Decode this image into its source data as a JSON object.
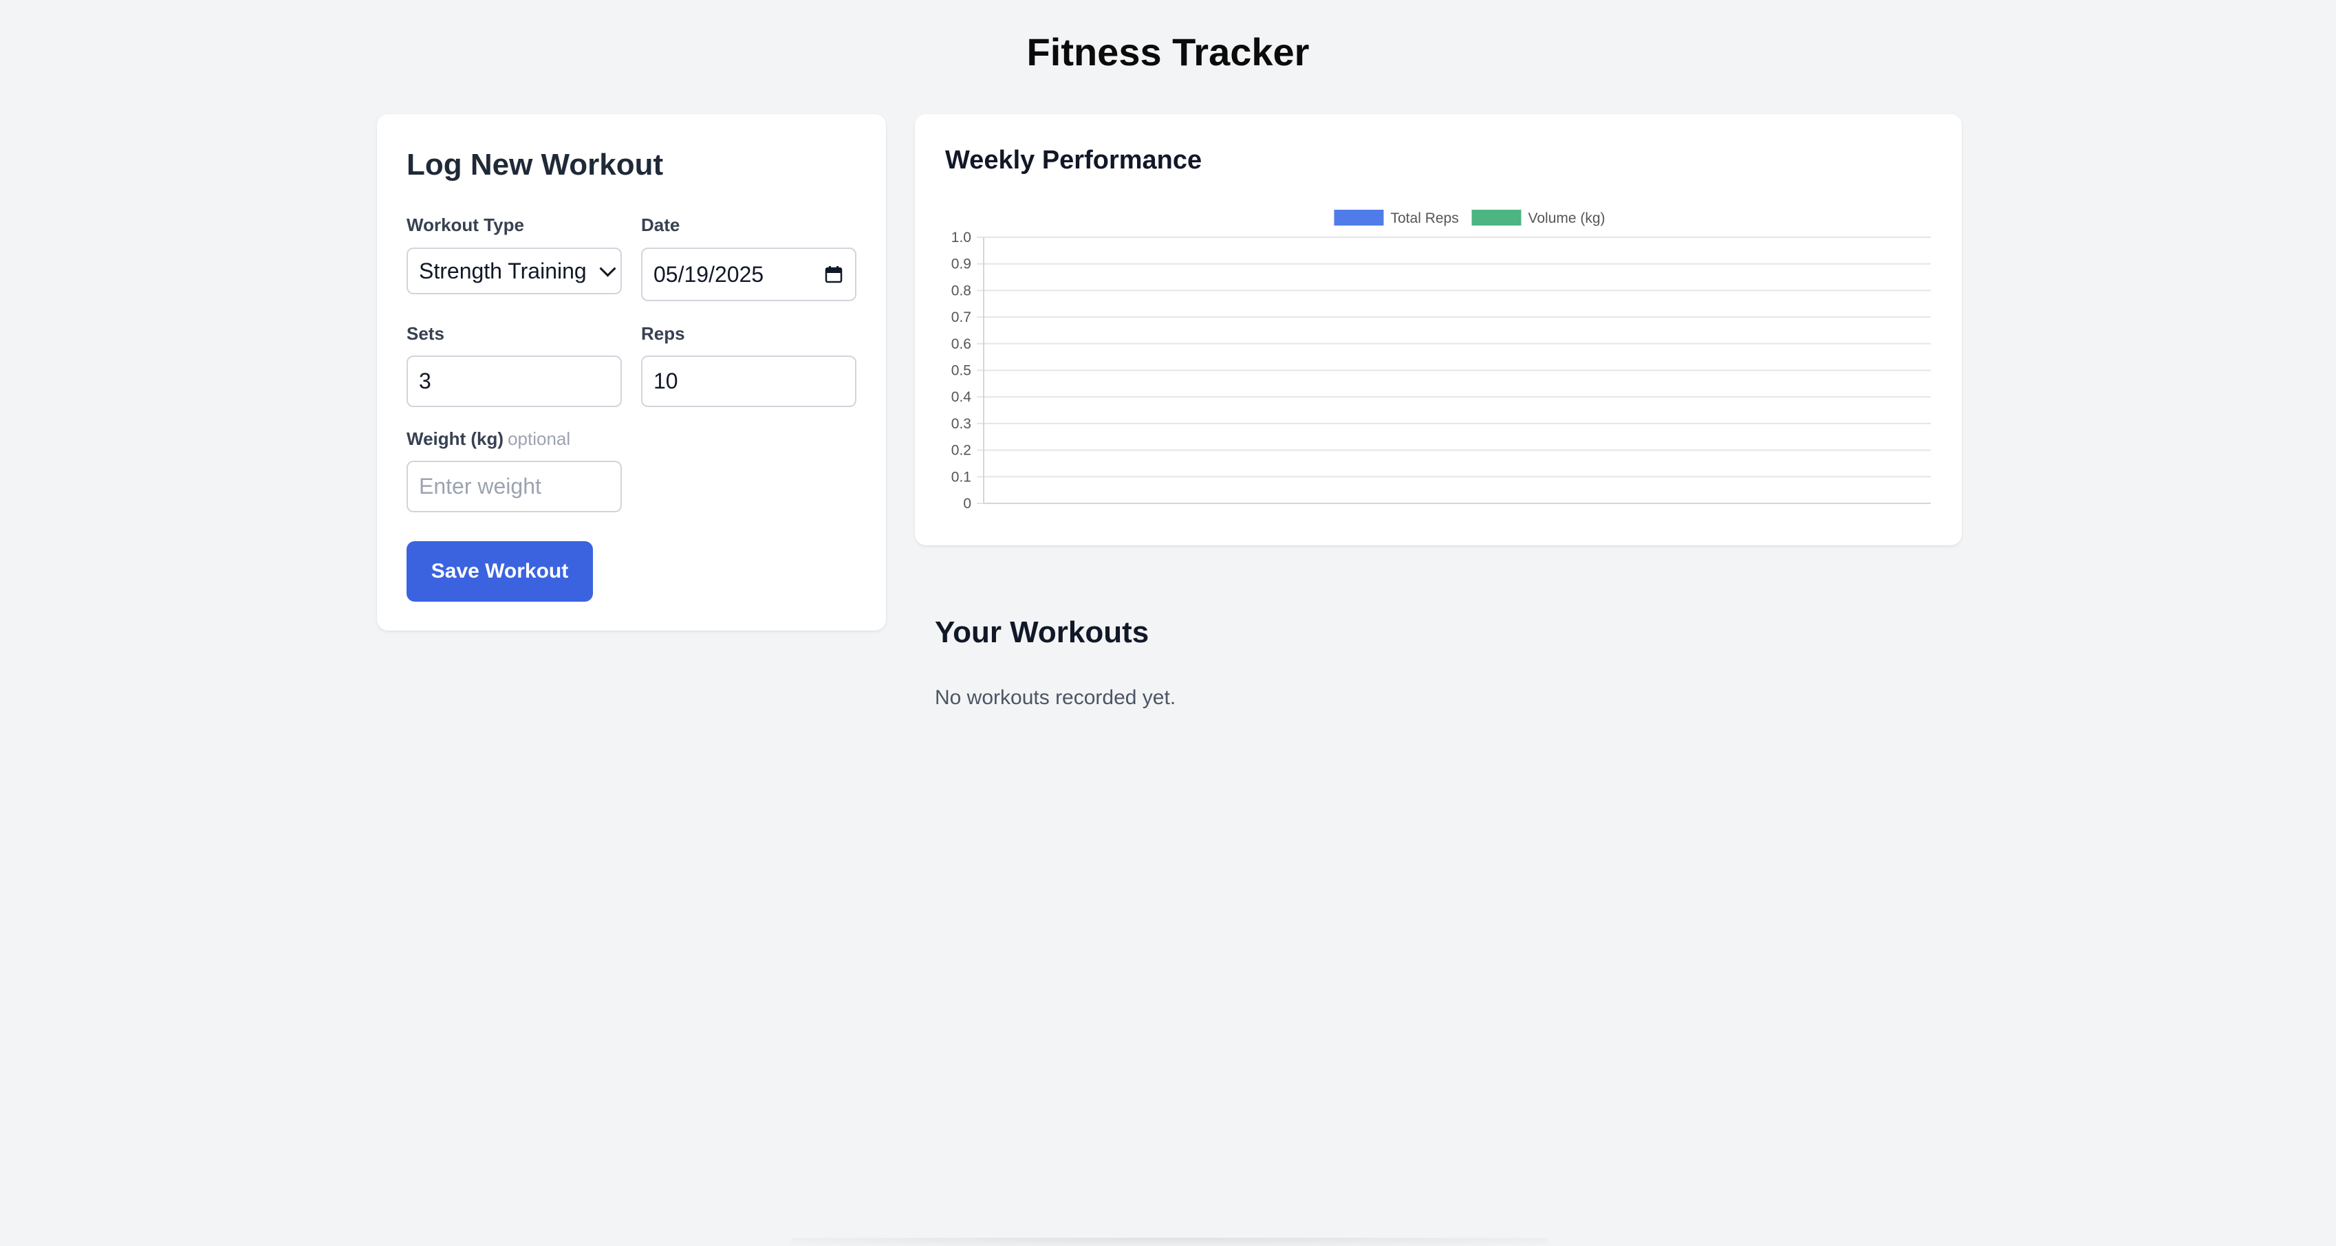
{
  "header": {
    "title": "Fitness Tracker"
  },
  "form": {
    "title": "Log New Workout",
    "workout_type": {
      "label": "Workout Type",
      "value": "Strength Training"
    },
    "date": {
      "label": "Date",
      "value": "05/19/2025"
    },
    "sets": {
      "label": "Sets",
      "value": "3"
    },
    "reps": {
      "label": "Reps",
      "value": "10"
    },
    "weight": {
      "label": "Weight (kg)",
      "optional_label": "optional",
      "placeholder": "Enter weight"
    },
    "save_label": "Save Workout",
    "accent_color": "#3b63e0"
  },
  "chart": {
    "title": "Weekly Performance"
  },
  "chart_data": {
    "type": "bar",
    "categories": [],
    "series": [
      {
        "name": "Total Reps",
        "color": "#4f7ce8",
        "values": []
      },
      {
        "name": "Volume (kg)",
        "color": "#4cb582",
        "values": []
      }
    ],
    "ylim": [
      0,
      1.0
    ],
    "yticks": [
      "0",
      "0.1",
      "0.2",
      "0.3",
      "0.4",
      "0.5",
      "0.6",
      "0.7",
      "0.8",
      "0.9",
      "1.0"
    ],
    "grid": true,
    "legend_position": "top-center"
  },
  "workouts": {
    "title": "Your Workouts",
    "empty_text": "No workouts recorded yet."
  }
}
